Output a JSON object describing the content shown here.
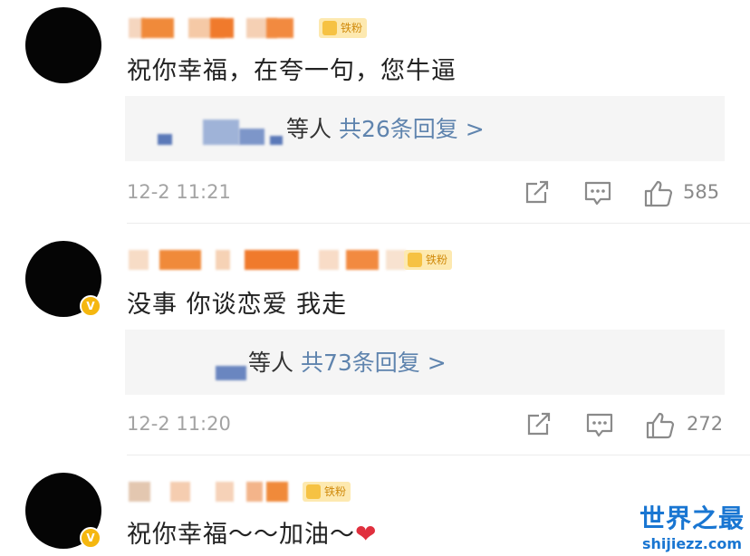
{
  "comments": [
    {
      "text": "祝你幸福，在夸一句，您牛逼",
      "fan_badge": "铁粉",
      "verified": false,
      "reply_suffix": "等人",
      "reply_count": "共26条回复 >",
      "time": "12-2 11:21",
      "likes": "585"
    },
    {
      "text": "没事 你谈恋爱 我走",
      "fan_badge": "铁粉",
      "verified": true,
      "verified_mark": "V",
      "reply_suffix": "等人",
      "reply_count": "共73条回复 >",
      "time": "12-2 11:20",
      "likes": "272"
    },
    {
      "text": "祝你幸福～～加油～",
      "emoji": "❤",
      "fan_badge": "铁粉",
      "verified": true,
      "verified_mark": "V"
    }
  ],
  "icons": {
    "share": "share-icon",
    "comment": "comment-icon",
    "like": "thumbs-up-icon"
  },
  "colors": {
    "reply_link": "#5f84ae",
    "fan_badge_bg": "#fde9b0",
    "verified_badge": "#f5b70f",
    "heart": "#e0303e",
    "watermark": "#1976d2"
  },
  "watermark": {
    "title": "世界之最",
    "url": "shijiezz.com"
  }
}
